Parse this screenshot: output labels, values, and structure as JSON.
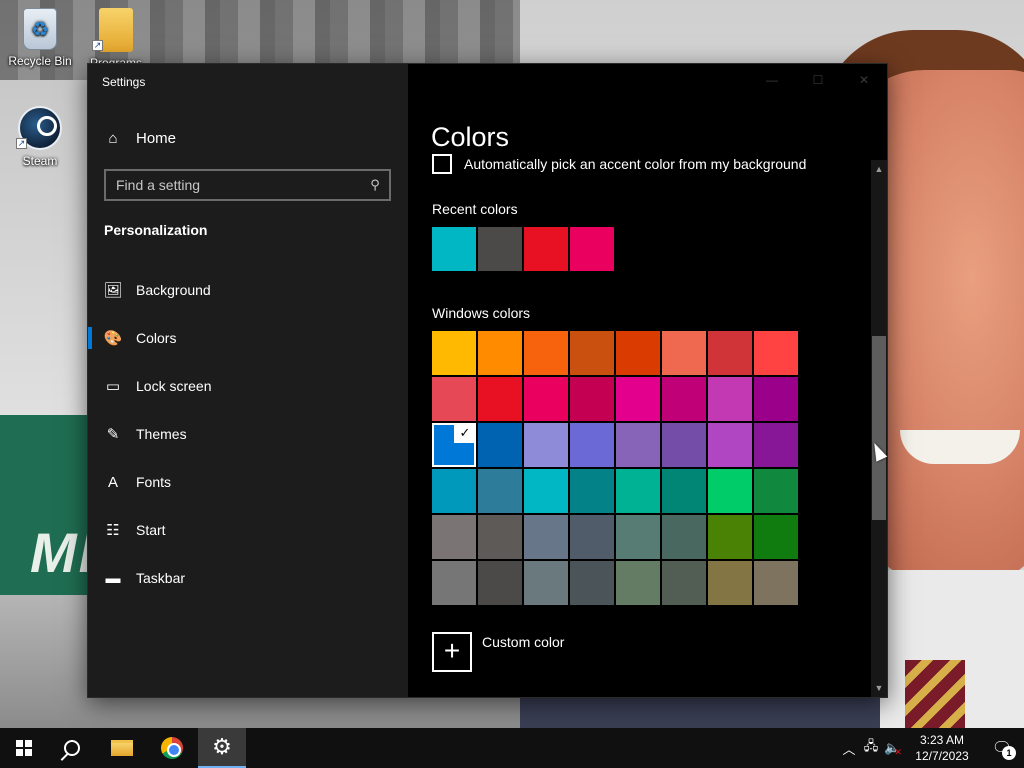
{
  "desktop": {
    "icons": [
      {
        "label": "Recycle Bin",
        "icon": "recycle-bin-icon"
      },
      {
        "label": "Programs Files",
        "icon": "folder-icon"
      },
      {
        "label": "Steam",
        "icon": "steam-icon"
      }
    ],
    "wallpaper_text": "ME"
  },
  "window": {
    "title": "Settings",
    "controls": [
      "—",
      "☐",
      "✕"
    ]
  },
  "nav": {
    "home_label": "Home",
    "search_placeholder": "Find a setting",
    "section_title": "Personalization",
    "items": [
      {
        "label": "Background",
        "icon": "picture-icon",
        "glyph": "🖼",
        "active": false
      },
      {
        "label": "Colors",
        "icon": "palette-icon",
        "glyph": "🎨",
        "active": true
      },
      {
        "label": "Lock screen",
        "icon": "lock-screen-icon",
        "glyph": "▭",
        "active": false
      },
      {
        "label": "Themes",
        "icon": "themes-icon",
        "glyph": "✎",
        "active": false
      },
      {
        "label": "Fonts",
        "icon": "fonts-icon",
        "glyph": "A",
        "active": false
      },
      {
        "label": "Start",
        "icon": "start-icon",
        "glyph": "☷",
        "active": false
      },
      {
        "label": "Taskbar",
        "icon": "taskbar-icon",
        "glyph": "▬",
        "active": false
      }
    ]
  },
  "content": {
    "title": "Colors",
    "auto_pick_label": "Automatically pick an accent color from my background",
    "recent_label": "Recent colors",
    "recent_colors": [
      "#00b7c3",
      "#4c4a48",
      "#e81123",
      "#ea005e"
    ],
    "windows_label": "Windows colors",
    "windows_colors": [
      "#ffb900",
      "#ff8c00",
      "#f7630c",
      "#ca5010",
      "#da3b01",
      "#ef6950",
      "#d13438",
      "#ff4343",
      "#e74856",
      "#e81123",
      "#ea005e",
      "#c30052",
      "#e3008c",
      "#bf0077",
      "#c239b3",
      "#9a0089",
      "#0078d7",
      "#0063b1",
      "#8e8cd8",
      "#6b69d6",
      "#8764b8",
      "#744da9",
      "#b146c2",
      "#881798",
      "#0099bc",
      "#2d7d9a",
      "#00b7c3",
      "#038387",
      "#00b294",
      "#018574",
      "#00cc6a",
      "#10893e",
      "#7a7574",
      "#5d5a58",
      "#68768a",
      "#515c6b",
      "#567c73",
      "#486860",
      "#498205",
      "#107c10",
      "#767676",
      "#4c4a48",
      "#69797e",
      "#4a5459",
      "#647c64",
      "#525e54",
      "#847545",
      "#7e735f"
    ],
    "selected_color": "#0078d7",
    "selected_check": "✓",
    "custom_color_label": "Custom color",
    "custom_plus": "+"
  },
  "taskbar": {
    "apps": [
      {
        "name": "start",
        "icon": "windows-logo-icon"
      },
      {
        "name": "search",
        "icon": "search-icon"
      },
      {
        "name": "file-explorer",
        "icon": "folder-icon"
      },
      {
        "name": "chrome",
        "icon": "chrome-icon"
      },
      {
        "name": "settings",
        "icon": "gear-icon",
        "active": true
      }
    ],
    "time": "3:23 AM",
    "date": "12/7/2023",
    "notification_count": "1"
  }
}
